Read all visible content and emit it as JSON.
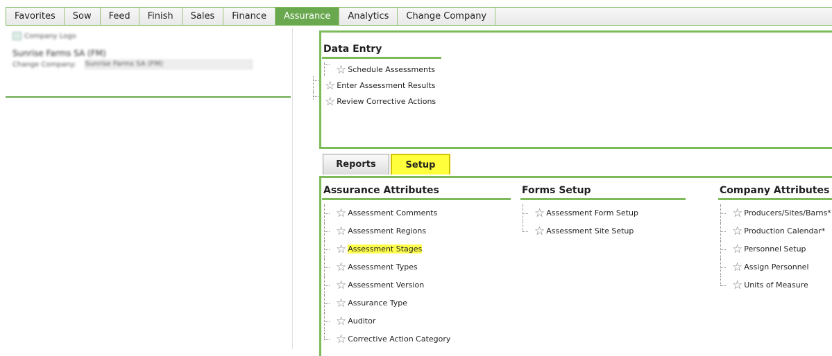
{
  "topnav": {
    "tabs": [
      {
        "label": "Favorites"
      },
      {
        "label": "Sow"
      },
      {
        "label": "Feed"
      },
      {
        "label": "Finish"
      },
      {
        "label": "Sales"
      },
      {
        "label": "Finance"
      },
      {
        "label": "Assurance"
      },
      {
        "label": "Analytics"
      },
      {
        "label": "Change Company"
      }
    ],
    "active_index": 6
  },
  "header": {
    "logo_alt": "Company Logo",
    "company_name": "Sunrise Farms SA (FM)",
    "change_company_label": "Change Company:",
    "change_company_value": "Sunrise Farms SA (FM)"
  },
  "data_entry": {
    "title": "Data Entry",
    "items": [
      {
        "label": "Schedule Assessments"
      },
      {
        "label": "Enter Assessment Results"
      },
      {
        "label": "Review Corrective Actions"
      }
    ]
  },
  "subtabs": {
    "items": [
      {
        "label": "Reports"
      },
      {
        "label": "Setup"
      }
    ],
    "active": "Setup"
  },
  "setup": {
    "assurance_attributes": {
      "title": "Assurance Attributes",
      "items": [
        {
          "label": "Assessment Comments"
        },
        {
          "label": "Assessment Regions"
        },
        {
          "label": "Assessment Stages"
        },
        {
          "label": "Assessment Types"
        },
        {
          "label": "Assessment Version"
        },
        {
          "label": "Assurance Type"
        },
        {
          "label": "Auditor"
        },
        {
          "label": "Corrective Action Category"
        }
      ]
    },
    "forms_setup": {
      "title": "Forms Setup",
      "items": [
        {
          "label": "Assessment Form Setup"
        },
        {
          "label": "Assessment Site Setup"
        }
      ]
    },
    "company_attributes": {
      "title": "Company Attributes",
      "items": [
        {
          "label": "Producers/Sites/Barns*"
        },
        {
          "label": "Production Calendar*"
        },
        {
          "label": "Personnel Setup"
        },
        {
          "label": "Assign Personnel"
        },
        {
          "label": "Units of Measure"
        }
      ]
    }
  },
  "colors": {
    "accent_green": "#6aa84f",
    "highlight_yellow": "#ffff4d"
  }
}
